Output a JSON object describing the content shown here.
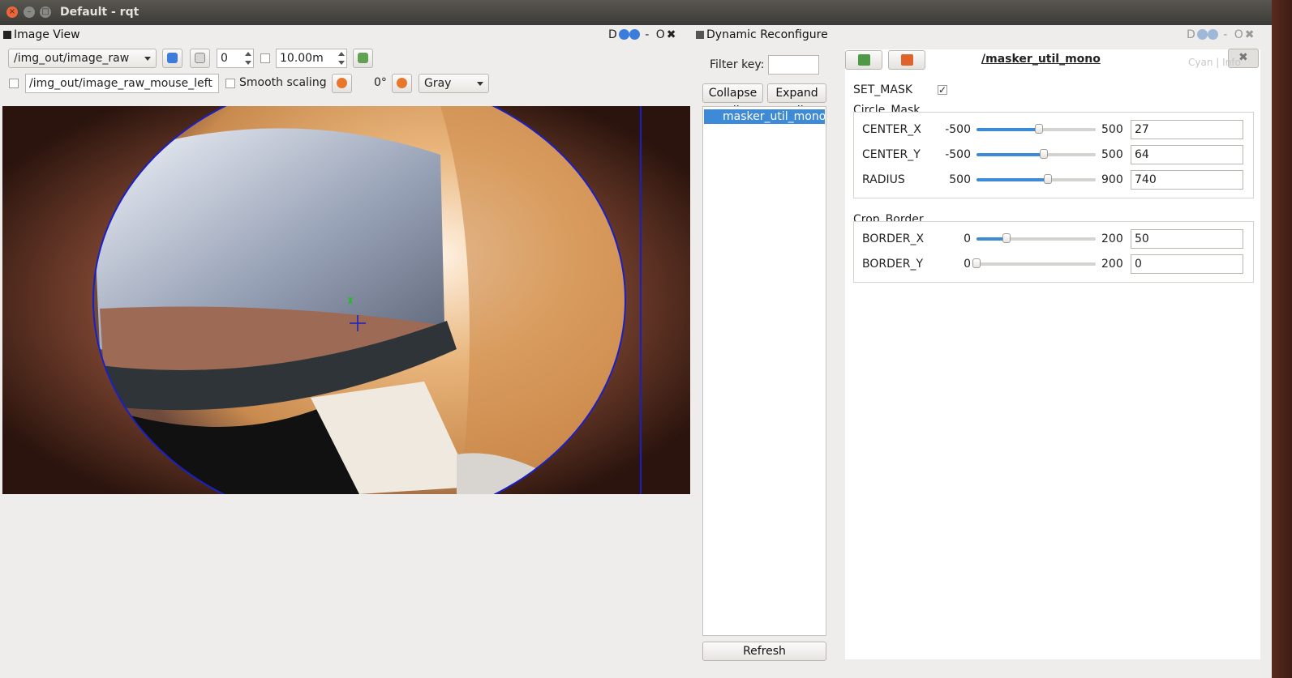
{
  "window": {
    "title": "Default - rqt",
    "close": "×",
    "minimize": "–",
    "maximize": "□"
  },
  "image_view": {
    "title": "Image View",
    "dock_controls": {
      "d": "D",
      "minus": "-",
      "o": "O",
      "x": "✖"
    },
    "topic": "/img_out/image_raw",
    "spin_value": "0",
    "duration": "10.00m",
    "mouse_topic": "/img_out/image_raw_mouse_left",
    "smooth_scaling": "Smooth scaling",
    "rotation": "0°",
    "color_scheme": "Gray"
  },
  "dynamic_reconfigure": {
    "title": "Dynamic Reconfigure",
    "dock_controls": {
      "d": "D",
      "minus": "-",
      "o": "O",
      "x": "✖"
    },
    "filter_key_label": "Filter key:",
    "filter_value": "",
    "collapse_all": "Collapse all",
    "expand_all": "Expand all",
    "tree_items": [
      "masker_util_mono"
    ],
    "refresh": "Refresh",
    "node_name": "/masker_util_mono",
    "set_mask": {
      "label": "SET_MASK",
      "checked": true,
      "mark": "✓"
    },
    "groups": [
      {
        "name": "Circle_Mask",
        "params": [
          {
            "name": "CENTER_X",
            "min": "-500",
            "max": "500",
            "value": "27",
            "ratio": 0.527
          },
          {
            "name": "CENTER_Y",
            "min": "-500",
            "max": "500",
            "value": "64",
            "ratio": 0.564
          },
          {
            "name": "RADIUS",
            "min": "500",
            "max": "900",
            "value": "740",
            "ratio": 0.6
          }
        ]
      },
      {
        "name": "Crop_Border",
        "params": [
          {
            "name": "BORDER_X",
            "min": "0",
            "max": "200",
            "value": "50",
            "ratio": 0.25
          },
          {
            "name": "BORDER_Y",
            "min": "0",
            "max": "200",
            "value": "0",
            "ratio": 0.0
          }
        ]
      }
    ]
  },
  "overlay_widget": {
    "label": "Cyan | Info",
    "close": "✖"
  }
}
